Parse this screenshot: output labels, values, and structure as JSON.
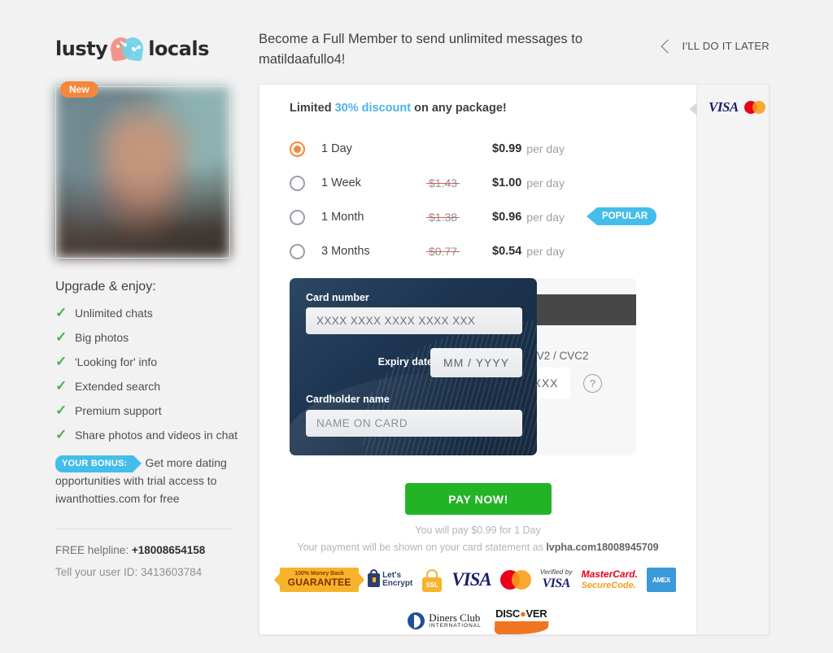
{
  "brand": {
    "name_left": "lusty",
    "name_right": "locals"
  },
  "profile": {
    "badge": "New"
  },
  "header": {
    "title": "Become a Full Member to send unlimited messages to matildaafullo4!",
    "later_label": "I'LL DO IT LATER"
  },
  "sidebar": {
    "upgrade_title": "Upgrade & enjoy:",
    "benefits": [
      "Unlimited chats",
      "Big photos",
      "'Looking for' info",
      "Extended search",
      "Premium support",
      "Share photos and videos in chat"
    ],
    "bonus_tag": "YOUR BONUS:",
    "bonus_text": "Get more dating opportunities with trial access to iwanthotties.com for free",
    "helpline_label": "FREE helpline:",
    "helpline_number": "+18008654158",
    "userid_text": "Tell your user ID: 3413603784"
  },
  "offer": {
    "discount_prefix": "Limited ",
    "discount_highlight": "30% discount",
    "discount_suffix": " on any package!",
    "popular_label": "POPULAR",
    "plans": [
      {
        "name": "1 Day",
        "old_price": "",
        "price": "$0.99",
        "per": "per day",
        "selected": true,
        "popular": false
      },
      {
        "name": "1 Week",
        "old_price": "$1.43",
        "price": "$1.00",
        "per": "per day",
        "selected": false,
        "popular": false
      },
      {
        "name": "1 Month",
        "old_price": "$1.38",
        "price": "$0.96",
        "per": "per day",
        "selected": false,
        "popular": true
      },
      {
        "name": "3 Months",
        "old_price": "$0.77",
        "price": "$0.54",
        "per": "per day",
        "selected": false,
        "popular": false
      }
    ]
  },
  "card_form": {
    "card_number_label": "Card number",
    "card_number_placeholder": "XXXX XXXX XXXX XXXX XXX",
    "expiry_label": "Expiry date",
    "expiry_placeholder": "MM  /  YYYY",
    "name_label": "Cardholder name",
    "name_placeholder": "NAME ON CARD",
    "cvv_label": "CVV2 / CVC2",
    "cvv_placeholder": "XXX",
    "help_glyph": "?"
  },
  "checkout": {
    "pay_button": "PAY NOW!",
    "note_line1": "You will pay $0.99 for 1 Day",
    "note_line2_prefix": "Your payment will be shown on your card statement as ",
    "note_line2_descriptor": "lvpha.com18008945709"
  },
  "accepted_cards": {
    "visa": "VISA"
  },
  "trust_badges": {
    "money_back_top": "100% Money Back",
    "money_back_main": "GUARANTEE",
    "lets_encrypt_line1": "Let's",
    "lets_encrypt_line2": "Encrypt",
    "ssl": "SSL",
    "visa": "VISA",
    "verified_by": "Verified by",
    "verified_visa": "VISA",
    "mastercard_line1": "MasterCard.",
    "mastercard_line2": "SecureCode.",
    "amex": "AMEX",
    "diners_name": "Diners Club",
    "diners_sub": "INTERNATIONAL",
    "discover_a": "DISC",
    "discover_dot": "●",
    "discover_b": "VER"
  }
}
